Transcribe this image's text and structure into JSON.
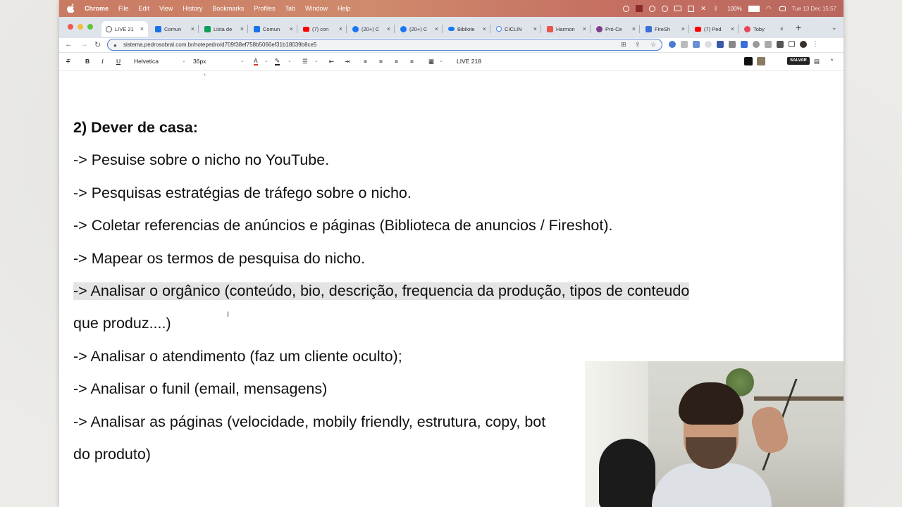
{
  "menubar": {
    "app": "Chrome",
    "items": [
      "File",
      "Edit",
      "View",
      "History",
      "Bookmarks",
      "Profiles",
      "Tab",
      "Window",
      "Help"
    ],
    "battery": "100%",
    "datetime": "Tue 13 Dec  15:57"
  },
  "tabs": [
    {
      "title": "LIVE 21",
      "fav_color": "#555555",
      "active": true
    },
    {
      "title": "Comun",
      "fav_color": "#1a73e8"
    },
    {
      "title": "Lista de",
      "fav_color": "#0f9d58"
    },
    {
      "title": "Comun",
      "fav_color": "#1a73e8"
    },
    {
      "title": "(7) con",
      "fav_color": "#ff0000"
    },
    {
      "title": "(20+) C",
      "fav_color": "#1877f2"
    },
    {
      "title": "(20+) C",
      "fav_color": "#1877f2"
    },
    {
      "title": "Bibliote",
      "fav_color": "#1877f2"
    },
    {
      "title": "CICLIN",
      "fav_color": "#4285f4"
    },
    {
      "title": "Harmon",
      "fav_color": "#e8574d"
    },
    {
      "title": "Pró-Ce",
      "fav_color": "#7b3f8c"
    },
    {
      "title": "FireSh",
      "fav_color": "#3a6fd8"
    },
    {
      "title": "(7) Ped",
      "fav_color": "#ff0000"
    },
    {
      "title": "Toby",
      "fav_color": "#e8455a"
    }
  ],
  "address": {
    "url": "sistema.pedrosobral.com.br/notepedro/d709f38ef758b5066ef31b18039b8ce5"
  },
  "toolbar": {
    "font": "Helvetica",
    "size": "36px",
    "doc_label": "LIVE 218",
    "save_label": "SALVAR",
    "swatch1": "#111111",
    "swatch2": "#8a7a63"
  },
  "document": {
    "heading": "2) Dever de casa:",
    "lines": [
      "-> Pesuise sobre o nicho no YouTube.",
      "-> Pesquisas estratégias de tráfego sobre o nicho.",
      "-> Coletar referencias de anúncios e páginas (Biblioteca de anuncios / Fireshot).",
      "-> Mapear os termos de pesquisa do nicho.",
      "-> Analisar o orgânico (conteúdo, bio, descrição, frequencia da produção, tipos de conteudo",
      "que produz....)",
      "-> Analisar o atendimento (faz um cliente oculto);",
      "-> Analisar o funil (email, mensagens)",
      "-> Analisar as páginas (velocidade, mobily friendly, estrutura, copy, bot",
      "do produto)"
    ]
  }
}
